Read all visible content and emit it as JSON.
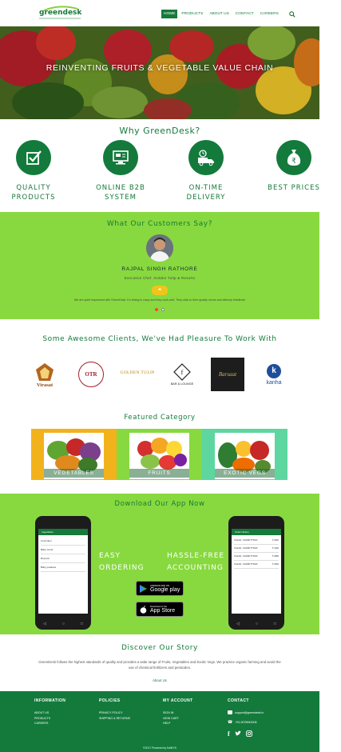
{
  "brand": {
    "logo_text": "greendesk",
    "primary": "#137a3c",
    "accent": "#88d93f"
  },
  "nav": {
    "items": [
      {
        "label": "HOME",
        "active": true
      },
      {
        "label": "PRODUCTS",
        "active": false
      },
      {
        "label": "ABOUT US",
        "active": false
      },
      {
        "label": "CONTACT",
        "active": false
      },
      {
        "label": "CAREERS",
        "active": false
      }
    ],
    "search_icon": "search-icon"
  },
  "hero": {
    "title": "REINVENTING FRUITS & VEGETABLE VALUE CHAIN"
  },
  "why": {
    "title": "Why GreenDesk?",
    "features": [
      {
        "icon": "checkbox-icon",
        "line1": "QUALITY",
        "line2": "PRODUCTS"
      },
      {
        "icon": "monitor-icon",
        "line1": "ONLINE B2B",
        "line2": "SYSTEM"
      },
      {
        "icon": "delivery-truck-icon",
        "line1": "ON-TIME",
        "line2": "DELIVERY"
      },
      {
        "icon": "money-bag-icon",
        "line1": "BEST PRICES",
        "line2": ""
      }
    ]
  },
  "testimonials": {
    "title": "What Our Customers Say?",
    "name": "RAJPAL SINGH RATHORE",
    "role": "Executive Chef, Golden Tulip & Resorts",
    "text": "We are quiet impressed with GreenDesk. It's timing is crazy and they work well. They stick to their quality norms and delivery timelines!"
  },
  "clients": {
    "title": "Some Awesome Clients, We've Had Pleasure To Work With",
    "logos": [
      {
        "name": "Virasat",
        "label": "Virasat"
      },
      {
        "name": "OTR",
        "label": "OTR"
      },
      {
        "name": "Golden Tulip",
        "label": "GOLDEN TULIP"
      },
      {
        "name": "Bar & Lounge",
        "label": "BAR & LOUNGE"
      },
      {
        "name": "Barsaat",
        "label": "Barsaat"
      },
      {
        "name": "Kanha",
        "label": "kanha"
      }
    ]
  },
  "featured": {
    "title": "Featured Category",
    "categories": [
      {
        "label": "VEGETABLES",
        "bg": "#f2b21b"
      },
      {
        "label": "FRUITS",
        "bg": "#88d93f"
      },
      {
        "label": "EXOTIC VEGS",
        "bg": "#5ed6a0"
      }
    ]
  },
  "app": {
    "title": "Download Our App Now",
    "left_label": [
      "EASY",
      "ORDERING"
    ],
    "right_label": [
      "HASSLE-FREE",
      "ACCOUNTING"
    ],
    "google": {
      "small": "ANDROID APP ON",
      "big": "Google play"
    },
    "apple": {
      "small": "Download on the",
      "big": "App Store"
    },
    "phone_left_title": "Vegetables",
    "phone_right_title": "Order History",
    "products": [
      "Cucumber",
      "Baby carrot",
      "Broccoli",
      "Baby potatoes"
    ],
    "orders": [
      {
        "id": "OrderID : #G18977T4523",
        "amount": "₹ 2060",
        "status": "Processing"
      },
      {
        "id": "OrderID : #G18977T4525",
        "amount": "₹ 1260",
        "status": "Processing"
      },
      {
        "id": "OrderID : #G18977T4530",
        "amount": "₹ 2880",
        "status": "Processing"
      },
      {
        "id": "OrderID : #G18977T4526",
        "amount": "₹ 2060",
        "status": "Processing"
      }
    ]
  },
  "story": {
    "title": "Discover Our Story",
    "text": "GreenDesk follows the highest standards of quality and provides a wide range of Fruits, Vegetables and Exotic Vegs. We practice organic farming and avoid the use of chemical fertilizers and pesticides.",
    "link": "About Us"
  },
  "footer": {
    "information": {
      "head": "INFORMATION",
      "links": [
        "ABOUT US",
        "PRODUCTS",
        "CAREERS"
      ]
    },
    "policies": {
      "head": "POLICIES",
      "links": [
        "PRIVACY POLICY",
        "SHIPPING & RETURNS"
      ]
    },
    "account": {
      "head": "MY ACCOUNT",
      "links": [
        "SIGN IN",
        "VIEW CART",
        "HELP"
      ]
    },
    "contact": {
      "head": "CONTACT",
      "email": "support@greendesk.in",
      "phone": "+91-9078943208"
    },
    "copyright": "©2017 Powered by KalNYS"
  }
}
